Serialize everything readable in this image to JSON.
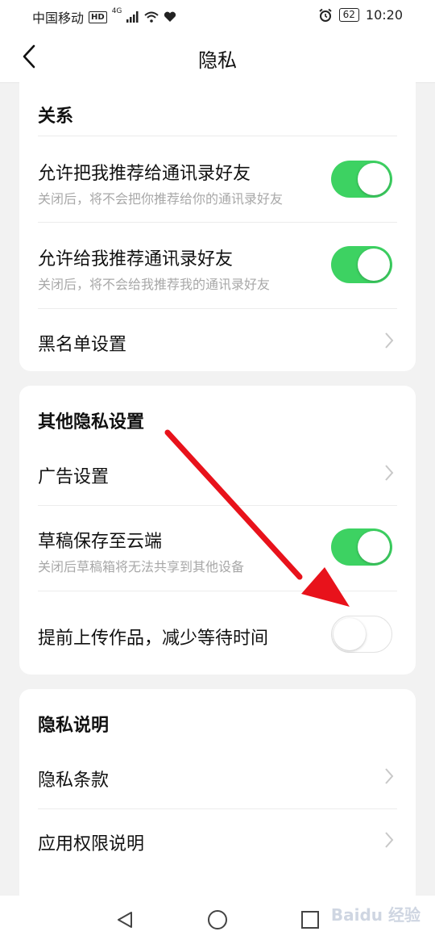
{
  "status_bar": {
    "carrier": "中国移动",
    "hd": "HD",
    "network": "4G",
    "battery": "62",
    "time": "10:20"
  },
  "header": {
    "title": "隐私"
  },
  "sections": {
    "relations": {
      "title": "关系",
      "items": [
        {
          "label": "允许把我推荐给通讯录好友",
          "sub": "关闭后，将不会把你推荐给你的通讯录好友",
          "toggle": "on"
        },
        {
          "label": "允许给我推荐通讯录好友",
          "sub": "关闭后，将不会给我推荐我的通讯录好友",
          "toggle": "on"
        },
        {
          "label": "黑名单设置"
        }
      ]
    },
    "other": {
      "title": "其他隐私设置",
      "items": [
        {
          "label": "广告设置"
        },
        {
          "label": "草稿保存至云端",
          "sub": "关闭后草稿箱将无法共享到其他设备",
          "toggle": "on"
        },
        {
          "label": "提前上传作品，减少等待时间",
          "toggle": "off"
        }
      ]
    },
    "explanation": {
      "title": "隐私说明",
      "items": [
        {
          "label": "隐私条款"
        },
        {
          "label": "应用权限说明"
        }
      ]
    }
  },
  "colors": {
    "toggle_on": "#3dd262",
    "arrow": "#e8121b"
  },
  "watermark": "Baidu 经验"
}
